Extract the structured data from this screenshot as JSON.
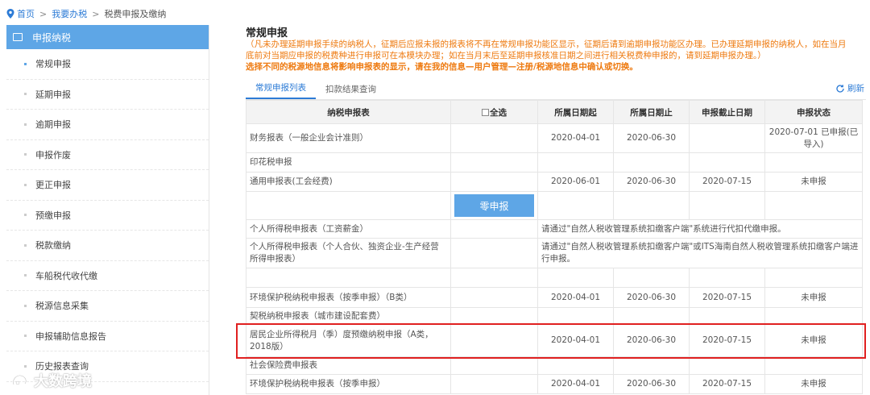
{
  "breadcrumb": {
    "home": "首页",
    "level2": "我要办税",
    "level3": "税费申报及缴纳",
    "sep": ">"
  },
  "sidebar": {
    "header": "申报纳税",
    "items": [
      {
        "label": "常规申报"
      },
      {
        "label": "延期申报"
      },
      {
        "label": "逾期申报"
      },
      {
        "label": "申报作废"
      },
      {
        "label": "更正申报"
      },
      {
        "label": "预缴申报"
      },
      {
        "label": "税款缴纳"
      },
      {
        "label": "车船税代收代缴"
      },
      {
        "label": "税源信息采集"
      },
      {
        "label": "申报辅助信息报告"
      },
      {
        "label": "历史报表查询"
      }
    ]
  },
  "main": {
    "title": "常规申报",
    "notice_line1": "（凡未办理延期申报手续的纳税人，征期后应报未报的报表将不再在常规申报功能区显示，征期后请到逾期申报功能区办理。已办理延期申报的纳税人，如在当月",
    "notice_line2": "底前对当期应申报的税费种进行申报可在本模块办理；如在当月末后至延期申报核准日期之间进行相关税费种申报的，请到延期申报办理。）",
    "notice_strong": "选择不同的税源地信息将影响申报表的显示，请在我的信息—用户管理—注册/税源地信息中确认或切换。",
    "tabs": [
      "常规申报列表",
      "扣款结果查询"
    ],
    "refresh": "刷新"
  },
  "table": {
    "headers": {
      "name": "纳税申报表",
      "select_all": "全选",
      "start": "所属日期起",
      "end": "所属日期止",
      "deadline": "申报截止日期",
      "status": "申报状态"
    },
    "zero_button": "零申报",
    "rows": [
      {
        "name": "财务报表（一般企业会计准则）",
        "start": "2020-04-01",
        "end": "2020-06-30",
        "deadline": "",
        "status": "2020-07-01 已申报(已导入)"
      },
      {
        "name": "印花税申报"
      },
      {
        "name": "通用申报表(工会经费)",
        "start": "2020-06-01",
        "end": "2020-06-30",
        "deadline": "2020-07-15",
        "status": "未申报"
      },
      {
        "name": "个人所得税申报表（工资薪金）",
        "note": "请通过\"自然人税收管理系统扣缴客户端\"系统进行代扣代缴申报。"
      },
      {
        "name": "个人所得税申报表（个人合伙、独资企业-生产经营所得申报表）",
        "note": "请通过\"自然人税收管理系统扣缴客户端\"或ITS海南自然人税收管理系统扣缴客户端进行申报。"
      },
      {
        "name": "环境保护税纳税申报表（按季申报）（B类）",
        "start": "2020-04-01",
        "end": "2020-06-30",
        "deadline": "2020-07-15",
        "status": "未申报"
      },
      {
        "name": "契税纳税申报表（城市建设配套费）"
      },
      {
        "name": "居民企业所得税月（季）度预缴纳税申报（A类，2018版）",
        "start": "2020-04-01",
        "end": "2020-06-30",
        "deadline": "2020-07-15",
        "status": "未申报"
      },
      {
        "name": "社会保险费申报表"
      },
      {
        "name": "环境保护税纳税申报表（按季申报）",
        "start": "2020-04-01",
        "end": "2020-06-30",
        "deadline": "2020-07-15",
        "status": "未申报"
      }
    ]
  },
  "watermark": "大数跨境",
  "colors": {
    "accent": "#5ea6e6",
    "link": "#2c7bd6",
    "notice": "#ee7a10",
    "highlight": "#e02020"
  }
}
